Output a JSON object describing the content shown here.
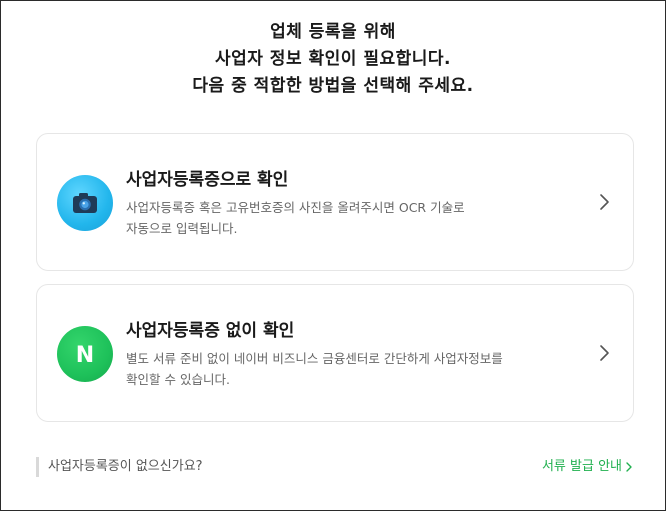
{
  "heading": {
    "line1": "업체 등록을 위해",
    "line2": "사업자 정보 확인이 필요합니다.",
    "line3": "다음 중 적합한 방법을 선택해 주세요."
  },
  "options": [
    {
      "icon": "camera-icon",
      "title": "사업자등록증으로 확인",
      "desc_line1": "사업자등록증 혹은 고유번호증의 사진을 올려주시면 OCR 기술로",
      "desc_line2": "자동으로 입력됩니다."
    },
    {
      "icon": "naver-n-icon",
      "icon_letter": "N",
      "title": "사업자등록증 없이 확인",
      "desc_line1": "별도 서류 준비 없이 네이버 비즈니스 금융센터로 간단하게 사업자정보를",
      "desc_line2": "확인할 수 있습니다."
    }
  ],
  "footer": {
    "question": "사업자등록증이 없으신가요?",
    "guide_link": "서류 발급 안내"
  },
  "colors": {
    "accent_green": "#21b04f",
    "camera_blue": "#22b6ec",
    "naver_green": "#1ec15a"
  }
}
